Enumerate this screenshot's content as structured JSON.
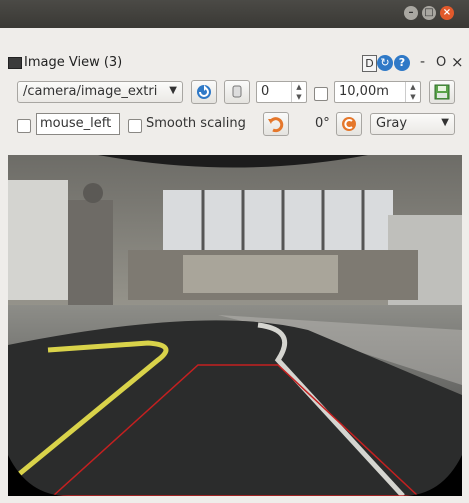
{
  "window": {
    "controls": {
      "minimize": "–",
      "maximize": "□",
      "close": "×"
    }
  },
  "panel": {
    "title": "Image View (3)",
    "dock_d": "D",
    "dock_help": "?",
    "dock_min": "-",
    "dock_float": "O",
    "dock_close": "×"
  },
  "toolbar": {
    "topic": "/camera/image_extri",
    "spin_value": "0",
    "max_value": "10,00m",
    "mouse_topic": "mouse_left",
    "smooth_scaling_label": "Smooth scaling",
    "rotation": "0°",
    "color_scheme": "Gray",
    "icons": {
      "refresh": "refresh-icon",
      "save": "save-icon",
      "rotate_left": "rotate-left-icon",
      "rotate_right": "rotate-right-icon"
    }
  },
  "colors": {
    "title_bar": "#3f3e3a",
    "window_close": "#e1592b",
    "accent_blue": "#2f79c7",
    "rotate_orange": "#e5772b",
    "road_lane": "#d9d34a",
    "roi_outline": "#c42020"
  }
}
